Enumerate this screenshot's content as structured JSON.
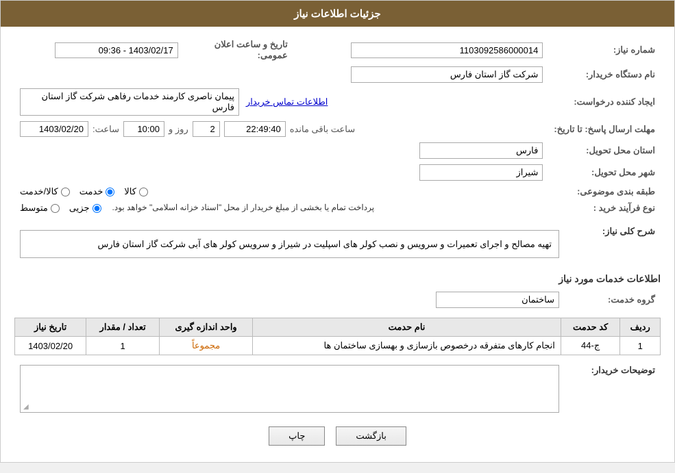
{
  "header": {
    "title": "جزئیات اطلاعات نیاز"
  },
  "fields": {
    "order_number_label": "شماره نیاز:",
    "order_number_value": "1103092586000014",
    "org_name_label": "نام دستگاه خریدار:",
    "org_name_value": "شرکت گاز استان فارس",
    "creator_label": "ایجاد کننده درخواست:",
    "creator_value": "پیمان ناصری کارمند خدمات رفاهی شرکت گاز استان فارس",
    "creator_link": "اطلاعات تماس خریدار",
    "deadline_label": "مهلت ارسال پاسخ: تا تاریخ:",
    "deadline_date": "1403/02/20",
    "deadline_time_label": "ساعت:",
    "deadline_time_value": "10:00",
    "deadline_days_label": "روز و",
    "deadline_days_value": "2",
    "deadline_remaining_label": "ساعت باقی مانده",
    "deadline_remaining_value": "22:49:40",
    "announce_label": "تاریخ و ساعت اعلان عمومی:",
    "announce_value": "1403/02/17 - 09:36",
    "province_label": "استان محل تحویل:",
    "province_value": "فارس",
    "city_label": "شهر محل تحویل:",
    "city_value": "شیراز",
    "category_label": "طبقه بندی موضوعی:",
    "category_options": [
      "کالا",
      "خدمت",
      "کالا/خدمت"
    ],
    "category_selected": "خدمت",
    "process_label": "نوع فرآیند خرید :",
    "process_options": [
      "جزیی",
      "متوسط"
    ],
    "process_notice": "پرداخت تمام یا بخشی از مبلغ خریدار از محل \"اسناد خزانه اسلامی\" خواهد بود.",
    "description_label": "شرح کلی نیاز:",
    "description_value": "تهیه مصالح و اجرای تعمیرات و سرویس و نصب کولر های اسپلیت در شیراز و سرویس کولر های آبی شرکت گاز استان فارس",
    "services_section_label": "اطلاعات خدمات مورد نیاز",
    "service_group_label": "گروه خدمت:",
    "service_group_value": "ساختمان",
    "table": {
      "headers": [
        "ردیف",
        "کد حدمت",
        "نام حدمت",
        "واحد اندازه گیری",
        "تعداد / مقدار",
        "تاریخ نیاز"
      ],
      "rows": [
        {
          "row_num": "1",
          "service_code": "ج-44",
          "service_name": "انجام کارهای متفرقه درخصوص بازسازی و بهسازی ساختمان ها",
          "unit": "مجموعاً",
          "quantity": "1",
          "date": "1403/02/20"
        }
      ]
    },
    "buyer_notes_label": "توضیحات خریدار:",
    "buyer_notes_value": "",
    "buttons": {
      "print": "چاپ",
      "back": "بازگشت"
    }
  }
}
